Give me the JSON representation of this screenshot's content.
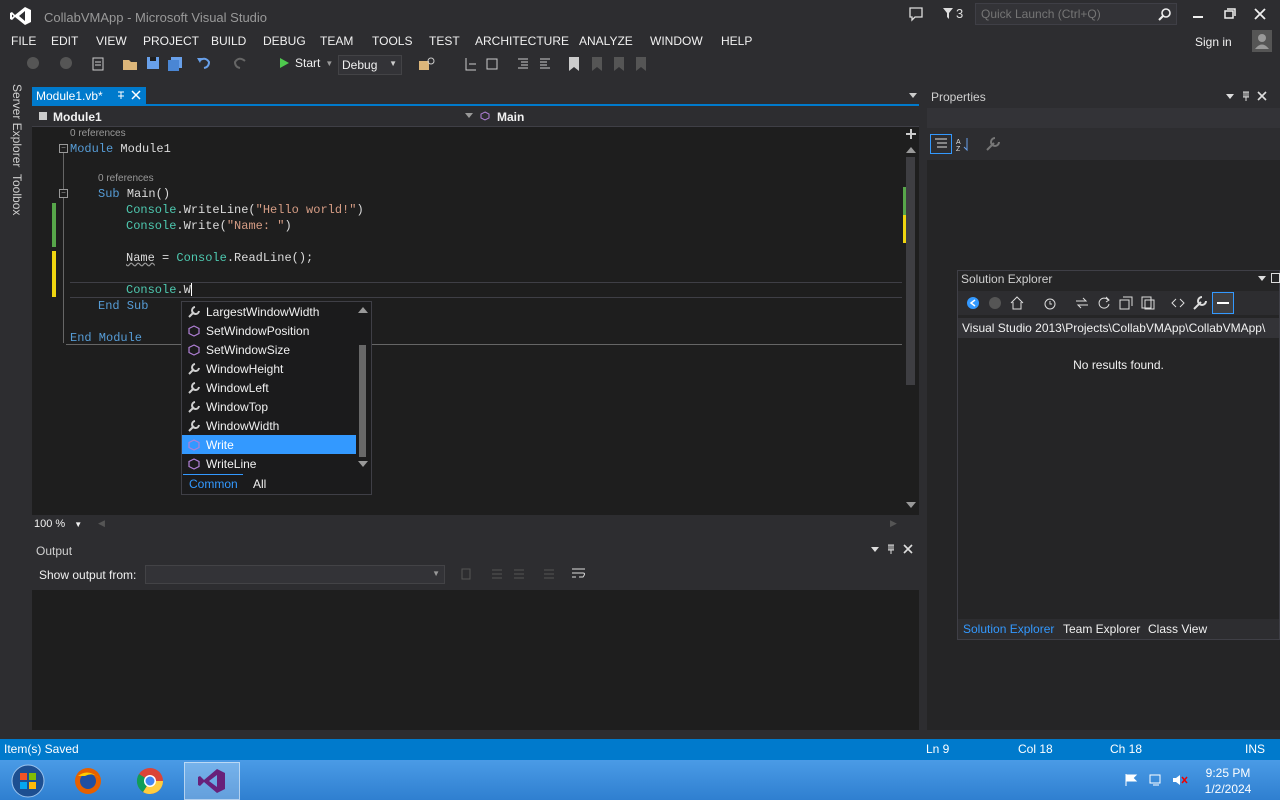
{
  "window": {
    "title": "CollabVMApp - Microsoft Visual Studio",
    "notification_count": "3",
    "quick_launch_placeholder": "Quick Launch (Ctrl+Q)"
  },
  "menu": [
    "FILE",
    "EDIT",
    "VIEW",
    "PROJECT",
    "BUILD",
    "DEBUG",
    "TEAM",
    "TOOLS",
    "TEST",
    "ARCHITECTURE",
    "ANALYZE",
    "WINDOW",
    "HELP"
  ],
  "sign_in": "Sign in",
  "toolbar": {
    "start_label": "Start",
    "config": "Debug"
  },
  "side_tabs": [
    "Server Explorer",
    "Toolbox"
  ],
  "editor": {
    "tab_label": "Module1.vb*",
    "nav_left": "Module1",
    "nav_right": "Main",
    "refs1": "0 references",
    "refs2": "0 references",
    "line_module": "Module",
    "line_module_name": "Module1",
    "line_sub": "Sub",
    "line_main": "Main()",
    "console": "Console",
    "writeline": ".WriteLine(",
    "hello_str": "\"Hello world!\"",
    "close_paren": ")",
    "write": ".Write(",
    "name_str": "\"Name: \"",
    "name_var": "Name",
    "assign": " = ",
    "readline": ".ReadLine();",
    "typing": ".W",
    "end_sub": "End Sub",
    "end_module": "End Module",
    "zoom": "100 %"
  },
  "completion": {
    "items": [
      {
        "label": "LargestWindowWidth",
        "icon": "wrench"
      },
      {
        "label": "SetWindowPosition",
        "icon": "method"
      },
      {
        "label": "SetWindowSize",
        "icon": "method"
      },
      {
        "label": "WindowHeight",
        "icon": "wrench"
      },
      {
        "label": "WindowLeft",
        "icon": "wrench"
      },
      {
        "label": "WindowTop",
        "icon": "wrench"
      },
      {
        "label": "WindowWidth",
        "icon": "wrench"
      },
      {
        "label": "Write",
        "icon": "method"
      },
      {
        "label": "WriteLine",
        "icon": "method"
      }
    ],
    "selected": "Write",
    "tab_common": "Common",
    "tab_all": "All"
  },
  "output": {
    "title": "Output",
    "show_output_from": "Show output from:"
  },
  "properties": {
    "title": "Properties"
  },
  "solution_explorer": {
    "title": "Solution Explorer",
    "path": "Visual Studio 2013\\Projects\\CollabVMApp\\CollabVMApp\\",
    "no_results": "No results found.",
    "tabs": [
      "Solution Explorer",
      "Team Explorer",
      "Class View"
    ]
  },
  "status": {
    "message": "Item(s) Saved",
    "ln": "Ln 9",
    "col": "Col 18",
    "ch": "Ch 18",
    "mode": "INS"
  },
  "taskbar": {
    "time": "9:25 PM",
    "date": "1/2/2024"
  },
  "colors": {
    "accent": "#007acc",
    "selection": "#3399ff",
    "editor_bg": "#1e1e1e",
    "chrome_bg": "#2d2d30"
  }
}
